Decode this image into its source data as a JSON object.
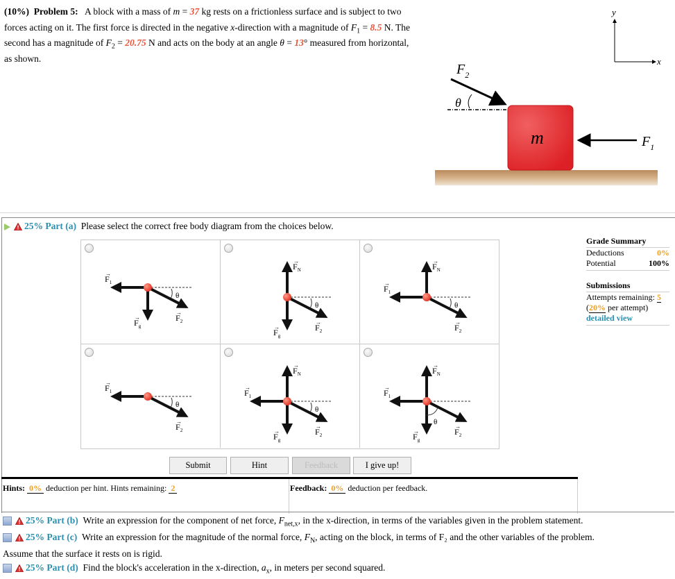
{
  "problem": {
    "weight": "(10%)",
    "title": "Problem 5:",
    "text1": "A block with a mass of ",
    "m_sym": "m",
    "eq": " = ",
    "m_val": "37",
    "text2": " kg rests on a frictionless surface and is subject to two forces acting on it. The first force is directed in the negative ",
    "x_sym": "x",
    "text3": "-direction with a magnitude of ",
    "F1_sym": "F",
    "F1_sub": "1",
    "F1_val": "8.5",
    "text4": " N. The second has a magnitude of ",
    "F2_sym": "F",
    "F2_sub": "2",
    "F2_val": "20.75",
    "text5": " N and acts on the body at an angle ",
    "theta_sym": "θ",
    "theta_val": "13",
    "text6": "° measured from horizontal, as shown."
  },
  "figure": {
    "y_label": "y",
    "x_label": "x",
    "F2_label": "F",
    "F2_sub": "2",
    "theta_label": "θ",
    "mass_label": "m",
    "F1_label": "F",
    "F1_sub": "1",
    "block_color": "#e52b2b",
    "floor_color": "#c8a072"
  },
  "part_a": {
    "weight": "25%",
    "label": "Part (a)",
    "prompt": "Please select the correct free body diagram from the choices below.",
    "choices": [
      {
        "forces": [
          "F1",
          "Fg",
          "F2"
        ],
        "theta": "θ"
      },
      {
        "forces": [
          "FN",
          "Fg",
          "F2"
        ],
        "theta": "θ"
      },
      {
        "forces": [
          "FN",
          "F1",
          "F2"
        ],
        "theta": "θ"
      },
      {
        "forces": [
          "F1",
          "F2"
        ],
        "theta": "θ"
      },
      {
        "forces": [
          "FN",
          "F1",
          "Fg",
          "F2"
        ],
        "theta": "θ"
      },
      {
        "forces": [
          "FN",
          "F1",
          "Fg",
          "F2"
        ],
        "theta": "θ",
        "theta_from": "vertical"
      }
    ],
    "buttons": {
      "submit": "Submit",
      "hint": "Hint",
      "feedback": "Feedback",
      "give_up": "I give up!"
    }
  },
  "grade_summary": {
    "title": "Grade Summary",
    "deductions_label": "Deductions",
    "deductions_value": "0%",
    "potential_label": "Potential",
    "potential_value": "100%",
    "submissions_title": "Submissions",
    "attempts_label": "Attempts remaining:",
    "attempts_value": "5",
    "per_attempt_pct": "20%",
    "per_attempt_text": "per attempt)",
    "detailed_view": "detailed view"
  },
  "hints": {
    "label": "Hints:",
    "pct": "0%",
    "text": "deduction per hint. Hints remaining:",
    "remaining": "2"
  },
  "feedback": {
    "label": "Feedback:",
    "pct": "0%",
    "text": "deduction per feedback."
  },
  "parts": [
    {
      "weight": "25%",
      "label": "Part (b)",
      "pre": "Write an expression for the component of net force, ",
      "sym": "F",
      "sub": "net,x",
      "post": ", in the x-direction, in terms of the variables given in the problem statement."
    },
    {
      "weight": "25%",
      "label": "Part (c)",
      "pre": "Write an expression for the magnitude of the normal force, ",
      "sym": "F",
      "sub": "N",
      "post": ", acting on the block, in terms of F₂ and the other variables of the problem.",
      "cont": "Assume that the surface it rests on is rigid."
    },
    {
      "weight": "25%",
      "label": "Part (d)",
      "pre": "Find the block's acceleration in the x-direction, ",
      "sym": "a",
      "sub": "x",
      "post": ", in meters per second squared."
    }
  ]
}
